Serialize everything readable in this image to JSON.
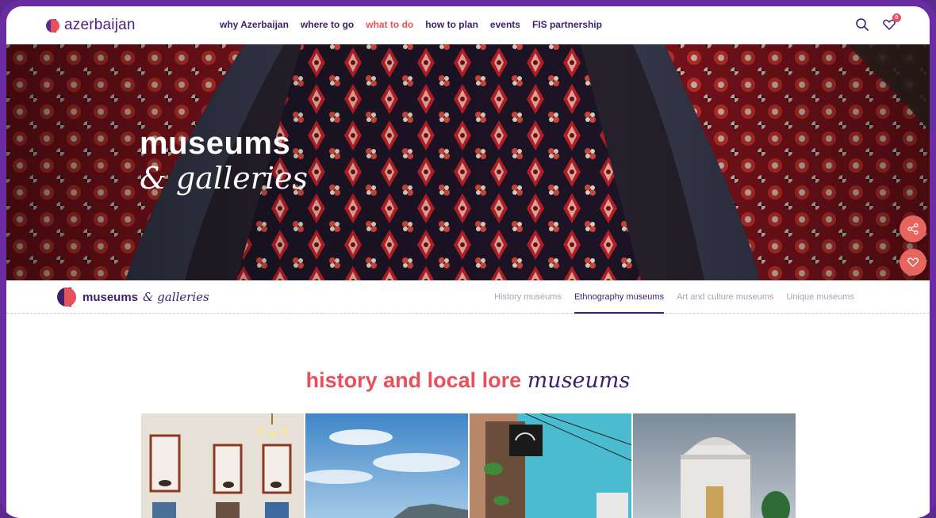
{
  "header": {
    "logo_text": "azerbaijan",
    "nav": [
      {
        "label": "why Azerbaijan"
      },
      {
        "label": "where to go"
      },
      {
        "label": "what to do",
        "active": true
      },
      {
        "label": "how to plan"
      },
      {
        "label": "events"
      },
      {
        "label": "FIS partnership"
      }
    ],
    "favorites_count": "0",
    "icons": [
      "search-icon",
      "heart-icon"
    ]
  },
  "hero": {
    "title_bold": "museums",
    "title_italic": "& galleries",
    "background": "carpet-display",
    "actions": [
      "share-icon",
      "heart-icon"
    ]
  },
  "subnav": {
    "brand_bold": "museums",
    "brand_italic": "& galleries",
    "tabs": [
      {
        "label": "History museums"
      },
      {
        "label": "Ethnography museums",
        "active": true
      },
      {
        "label": "Art and culture museums"
      },
      {
        "label": "Unique museums"
      }
    ]
  },
  "section": {
    "title_bold": "history and local lore",
    "title_italic": "museums"
  },
  "colors": {
    "brand_purple": "#3d1f6b",
    "accent_coral": "#e8505b",
    "frame": "#6a2ca0"
  }
}
